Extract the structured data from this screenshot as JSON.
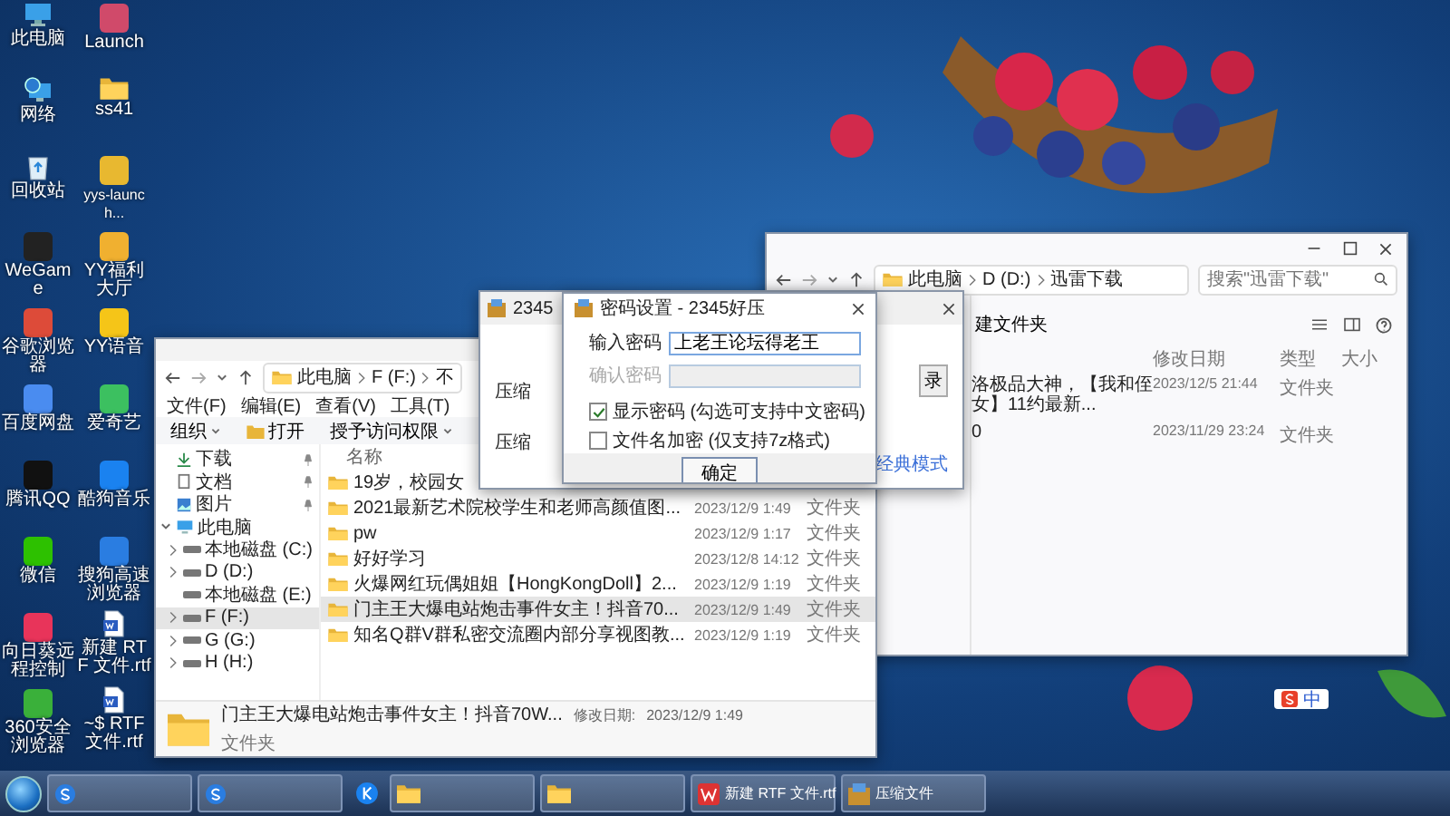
{
  "desktop_icons": [
    {
      "label": "此电脑",
      "kind": "computer"
    },
    {
      "label": "Launch",
      "kind": "app",
      "color": "#d04a6a"
    },
    {
      "label": "网络",
      "kind": "network"
    },
    {
      "label": "ss41",
      "kind": "folder"
    },
    {
      "label": "回收站",
      "kind": "recycle"
    },
    {
      "label": "yys-launch...",
      "kind": "app",
      "color": "#e8b830"
    },
    {
      "label": "WeGame",
      "kind": "app",
      "color": "#222222"
    },
    {
      "label": "YY福利大厅",
      "kind": "app",
      "color": "#f0b030"
    },
    {
      "label": "谷歌浏览器",
      "kind": "app",
      "color": "#dd4b39"
    },
    {
      "label": "YY语音",
      "kind": "app",
      "color": "#f5c518"
    },
    {
      "label": "百度网盘",
      "kind": "app",
      "color": "#4a8cf0"
    },
    {
      "label": "爱奇艺",
      "kind": "app",
      "color": "#3cc060"
    },
    {
      "label": "腾讯QQ",
      "kind": "app",
      "color": "#111111"
    },
    {
      "label": "酷狗音乐",
      "kind": "app",
      "color": "#1a82f0"
    },
    {
      "label": "微信",
      "kind": "app",
      "color": "#2dc100"
    },
    {
      "label": "搜狗高速浏览器",
      "kind": "app",
      "color": "#2a7de1"
    },
    {
      "label": "向日葵远程控制",
      "kind": "app",
      "color": "#e8345a"
    },
    {
      "label": "新建 RTF 文件.rtf",
      "kind": "doc"
    },
    {
      "label": "360安全浏览器",
      "kind": "app",
      "color": "#3ab03a"
    },
    {
      "label": "~$ RTF 文件.rtf",
      "kind": "doc"
    }
  ],
  "explorer_right": {
    "address": [
      "此电脑",
      "D (D:)",
      "迅雷下载"
    ],
    "search": {
      "placeholder": "搜索\"迅雷下载\""
    },
    "command": "建文件夹",
    "columns": [
      "修改日期",
      "类型",
      "大小"
    ],
    "files": [
      {
        "name": "洛极品大神，【我和侄女】11约最新...",
        "date": "2023/12/5 21:44",
        "type": "文件夹"
      },
      {
        "name": "0",
        "date": "2023/11/29 23:24",
        "type": "文件夹"
      }
    ]
  },
  "explorer_left": {
    "address": [
      "此电脑",
      "F (F:)",
      "不"
    ],
    "menu": [
      "文件(F)",
      "编辑(E)",
      "查看(V)",
      "工具(T)"
    ],
    "commands": [
      {
        "label": "组织",
        "kind": "dropdown"
      },
      {
        "label": "打开",
        "kind": "open"
      },
      {
        "label": "授予访问权限",
        "kind": "dropdown"
      }
    ],
    "nav": [
      {
        "label": "下载",
        "kind": "download",
        "pinned": true,
        "selected": false
      },
      {
        "label": "文档",
        "kind": "document",
        "pinned": true,
        "selected": false
      },
      {
        "label": "图片",
        "kind": "picture",
        "pinned": true,
        "selected": false
      },
      {
        "label": "此电脑",
        "kind": "computer",
        "pinned": false,
        "selected": false,
        "expanded": true,
        "children": [
          {
            "label": "本地磁盘 (C:)",
            "kind": "drive",
            "pinned": false,
            "selected": false,
            "expanded": false
          },
          {
            "label": "D (D:)",
            "kind": "drive",
            "pinned": false,
            "selected": false,
            "expanded": false
          },
          {
            "label": "本地磁盘 (E:)",
            "kind": "drive",
            "pinned": false,
            "selected": false
          },
          {
            "label": "F (F:)",
            "kind": "drive",
            "pinned": false,
            "selected": true,
            "expanded": false
          },
          {
            "label": "G (G:)",
            "kind": "drive",
            "pinned": false,
            "selected": false,
            "expanded": false
          },
          {
            "label": "H (H:)",
            "kind": "drive",
            "pinned": false,
            "selected": false,
            "expanded": false
          }
        ]
      }
    ],
    "columns": [
      "名称"
    ],
    "files": [
      {
        "name": "19岁，校园女",
        "selected": false
      },
      {
        "name": "2021最新艺术院校学生和老师高颜值图...",
        "date": "2023/12/9 1:49",
        "type": "文件夹",
        "selected": false
      },
      {
        "name": "pw",
        "date": "2023/12/9 1:17",
        "type": "文件夹",
        "selected": false
      },
      {
        "name": "好好学习",
        "date": "2023/12/8 14:12",
        "type": "文件夹",
        "selected": false
      },
      {
        "name": "火爆网红玩偶姐姐【HongKongDoll】2...",
        "date": "2023/12/9 1:19",
        "type": "文件夹",
        "selected": false
      },
      {
        "name": "门主王大爆电站炮击事件女主！抖音70...",
        "date": "2023/12/9 1:49",
        "type": "文件夹",
        "selected": true
      },
      {
        "name": "知名Q群V群私密交流圈内部分享视图教...",
        "date": "2023/12/9 1:19",
        "type": "文件夹",
        "selected": false
      }
    ],
    "details": {
      "name": "门主王大爆电站炮击事件女主！抖音70W...",
      "date_label": "修改日期:",
      "date": "2023/12/9 1:49",
      "type": "文件夹"
    }
  },
  "archive_window": {
    "title": "2345",
    "labels": [
      "压缩",
      "压缩"
    ],
    "button": "录",
    "link": "经典模式"
  },
  "password_dialog": {
    "title": "密码设置 - 2345好压",
    "fields": [
      {
        "label": "输入密码",
        "value": "上老王论坛得老王",
        "disabled": false
      },
      {
        "label": "确认密码",
        "disabled": true
      }
    ],
    "options": [
      {
        "label": "显示密码 (勾选可支持中文密码)",
        "checked": true
      },
      {
        "label": "文件名加密 (仅支持7z格式)",
        "checked": false
      }
    ],
    "button": "确定"
  },
  "ime_bar": {
    "label": "中"
  },
  "taskbar": {
    "items": [
      {
        "kind": "sogou"
      },
      {
        "kind": "sogou"
      },
      {
        "kind": "kugou"
      },
      {
        "kind": "folder"
      },
      {
        "kind": "folder"
      },
      {
        "kind": "wps",
        "label": "新建 RTF 文件.rtf"
      },
      {
        "kind": "archive",
        "label": "压缩文件"
      }
    ]
  }
}
